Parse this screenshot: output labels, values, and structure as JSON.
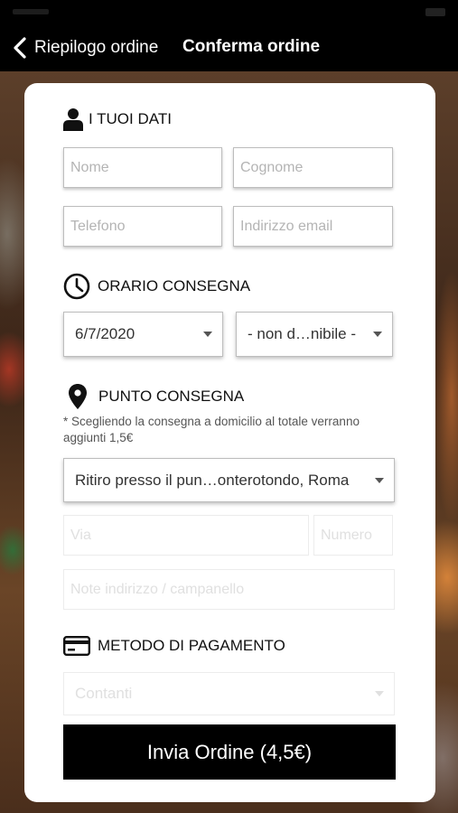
{
  "nav": {
    "back_label": "Riepilogo ordine",
    "title": "Conferma ordine"
  },
  "sections": {
    "personal": {
      "title": "I TUOI DATI",
      "icon": "person-icon",
      "fields": {
        "first_name_placeholder": "Nome",
        "last_name_placeholder": "Cognome",
        "phone_placeholder": "Telefono",
        "email_placeholder": "Indirizzo email"
      }
    },
    "delivery_time": {
      "title": "ORARIO CONSEGNA",
      "icon": "clock-icon",
      "date_value": "6/7/2020",
      "time_value": "- non d…nibile -"
    },
    "delivery_point": {
      "title": "PUNTO CONSEGNA",
      "icon": "location-pin-icon",
      "note": "* Scegliendo la consegna a domicilio al totale verranno aggiunti 1,5€",
      "selected_point": "Ritiro presso il pun…onterotondo, Roma",
      "street_placeholder": "Via",
      "number_placeholder": "Numero",
      "address_notes_placeholder": "Note indirizzo / campanello"
    },
    "payment": {
      "title": "METODO DI PAGAMENTO",
      "icon": "credit-card-icon",
      "method_value": "Contanti"
    }
  },
  "submit_label": "Invia Ordine (4,5€)"
}
